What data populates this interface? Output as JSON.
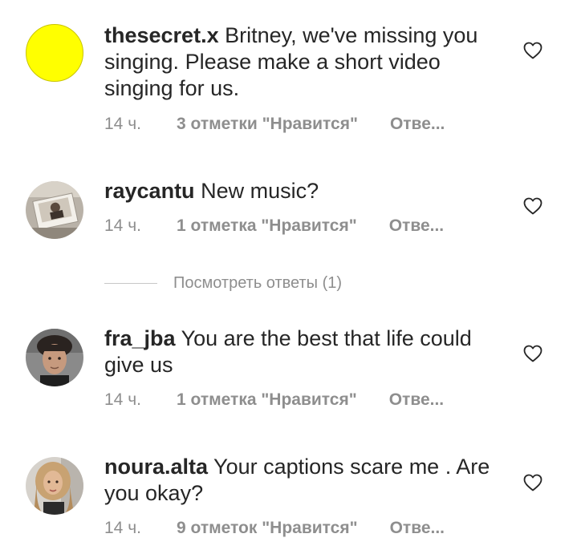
{
  "comments": [
    {
      "username": "thesecret.x",
      "text": "Britney, we've missing you singing. Please make a short video singing for us.",
      "time": "14 ч.",
      "likes": "3 отметки \"Нравится\"",
      "reply": "Отве...",
      "avatar_color": "#ffff00"
    },
    {
      "username": "raycantu",
      "text": "New music?",
      "time": "14 ч.",
      "likes": "1 отметка \"Нравится\"",
      "reply": "Отве..."
    },
    {
      "username": "fra_jba",
      "text": "You are the best that life could give us",
      "time": "14 ч.",
      "likes": "1 отметка \"Нравится\"",
      "reply": "Отве..."
    },
    {
      "username": "noura.alta",
      "text": "Your captions scare me . Are you okay?",
      "time": "14 ч.",
      "likes": "9 отметок \"Нравится\"",
      "reply": "Отве..."
    }
  ],
  "view_replies": "Посмотреть ответы (1)",
  "icons": {
    "like": "heart-outline-icon"
  },
  "colors": {
    "text": "#262626",
    "secondary": "#8e8e8e"
  }
}
